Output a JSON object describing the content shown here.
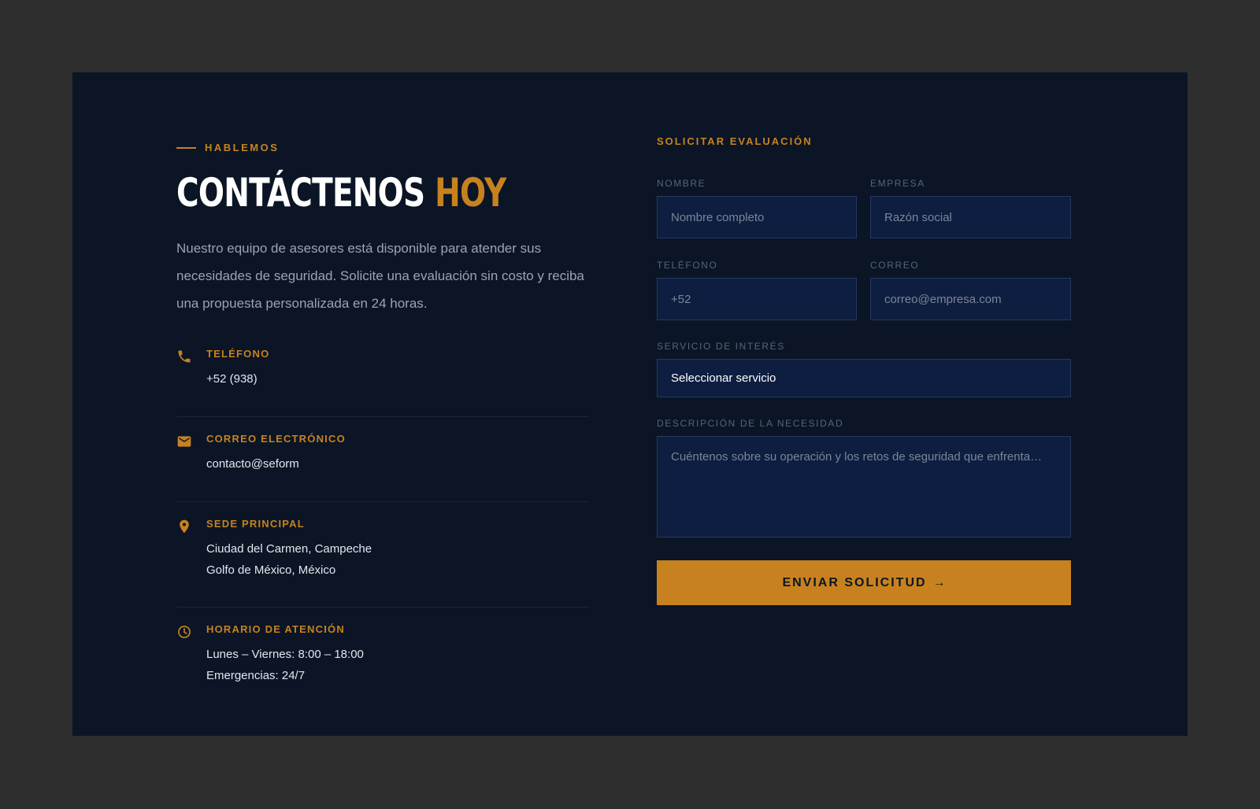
{
  "colors": {
    "accent": "#c7821f",
    "panel": "#0b1526",
    "field_bg": "#0e1e40"
  },
  "contact": {
    "eyebrow": "HABLEMOS",
    "title_main": "CONTÁCTENOS",
    "title_accent": "HOY",
    "intro": "Nuestro equipo de asesores está disponible para atender sus necesidades de seguridad. Solicite una evaluación sin costo y reciba una propuesta personalizada en 24 horas.",
    "items": [
      {
        "icon": "phone-icon",
        "label": "TELÉFONO",
        "lines": [
          "+52 (938)"
        ]
      },
      {
        "icon": "mail-icon",
        "label": "CORREO ELECTRÓNICO",
        "lines": [
          "contacto@seform"
        ]
      },
      {
        "icon": "location-pin-icon",
        "label": "SEDE PRINCIPAL",
        "lines": [
          "Ciudad del Carmen, Campeche",
          "Golfo de México, México"
        ]
      },
      {
        "icon": "clock-icon",
        "label": "HORARIO DE ATENCIÓN",
        "lines": [
          "Lunes – Viernes: 8:00 – 18:00",
          "Emergencias: 24/7"
        ]
      }
    ]
  },
  "form": {
    "title": "SOLICITAR EVALUACIÓN",
    "nombre": {
      "label": "NOMBRE",
      "placeholder": "Nombre completo"
    },
    "empresa": {
      "label": "EMPRESA",
      "placeholder": "Razón social"
    },
    "telefono": {
      "label": "TELÉFONO",
      "placeholder": "+52"
    },
    "correo": {
      "label": "CORREO",
      "placeholder": "correo@empresa.com"
    },
    "servicio": {
      "label": "SERVICIO DE INTERÉS",
      "value": "Seleccionar servicio"
    },
    "descripcion": {
      "label": "DESCRIPCIÓN DE LA NECESIDAD",
      "placeholder": "Cuéntenos sobre su operación y los retos de seguridad que enfrenta…"
    },
    "submit_label": "ENVIAR SOLICITUD",
    "submit_arrow": "→"
  }
}
